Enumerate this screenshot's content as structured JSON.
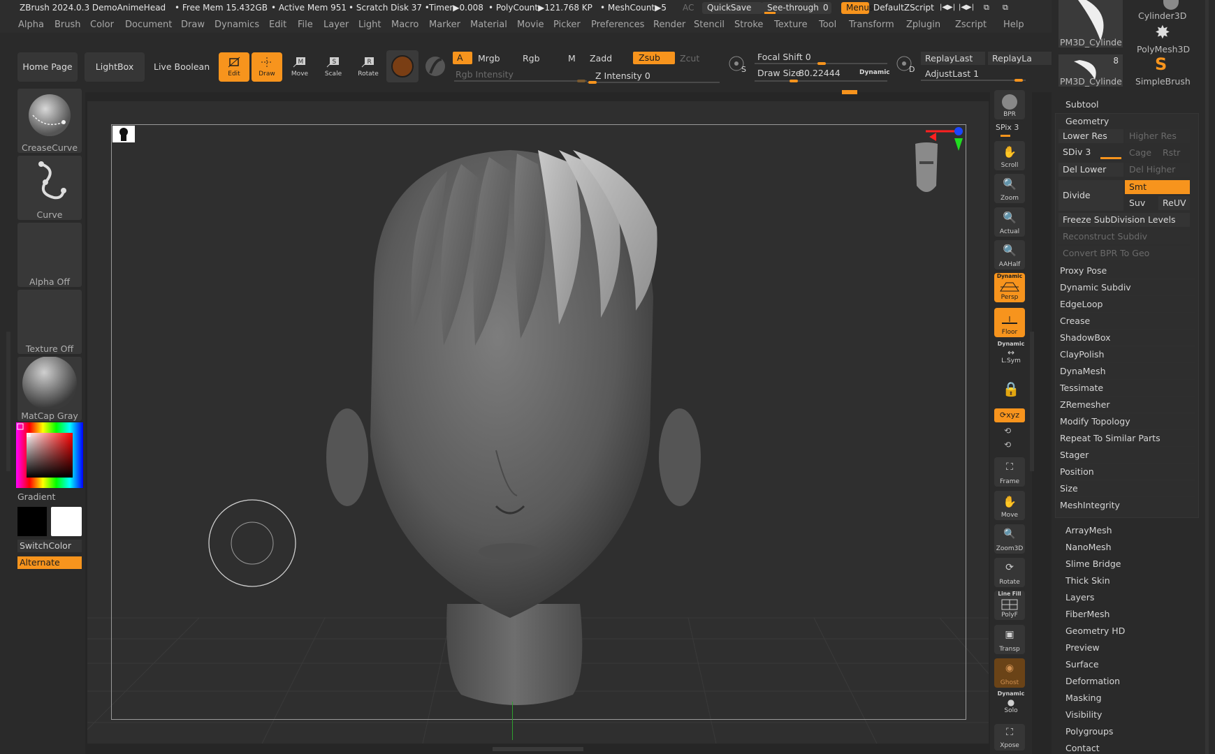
{
  "infobar": {
    "app_title": "ZBrush 2024.0.3 DemoAnimeHead",
    "free_mem": "• Free Mem 15.432GB",
    "active_mem": "• Active Mem 951",
    "scratch_disk": "• Scratch Disk 37 •",
    "timer": "Timer▶0.008",
    "polycount": "• PolyCount▶121.768 KP",
    "meshcount": "• MeshCount▶5",
    "ac": "AC",
    "quicksave": "QuickSave",
    "see_through": "See-through",
    "see_through_value": "0",
    "menus": "Menus",
    "default_zscript": "DefaultZScript"
  },
  "menubar": [
    "Alpha",
    "Brush",
    "Color",
    "Document",
    "Draw",
    "Dynamics",
    "Edit",
    "File",
    "Layer",
    "Light",
    "Macro",
    "Marker",
    "Material",
    "Movie",
    "Picker",
    "Preferences",
    "Render",
    "Stencil",
    "Stroke",
    "Texture",
    "Tool",
    "Transform",
    "Zplugin",
    "Zscript",
    "Help"
  ],
  "toolbar": {
    "home_page": "Home Page",
    "lightbox": "LightBox",
    "live_boolean": "Live Boolean",
    "edit": "Edit",
    "draw": "Draw",
    "move": "Move",
    "scale": "Scale",
    "rotate": "Rotate",
    "a": "A",
    "mrgb": "Mrgb",
    "rgb": "Rgb",
    "m": "M",
    "zadd": "Zadd",
    "zsub": "Zsub",
    "zcut": "Zcut",
    "rgb_intensity": "Rgb Intensity",
    "z_intensity": "Z Intensity 0",
    "focal_shift": "Focal Shift 0",
    "draw_size_label": "Draw Size",
    "draw_size_value": "80.22444",
    "dynamic": "Dynamic",
    "replay_last": "ReplayLast",
    "replay_last_rel": "ReplayLa",
    "adjust_last": "AdjustLast 1",
    "s_label": "S",
    "d_label": "D"
  },
  "leftshelf": {
    "brush1": "CreaseCurve",
    "brush2": "Curve",
    "alpha": "Alpha Off",
    "texture": "Texture Off",
    "material": "MatCap Gray",
    "gradient": "Gradient",
    "switchcolor": "SwitchColor",
    "alternate": "Alternate"
  },
  "righttools": {
    "bpr": "BPR",
    "spix": "SPix 3",
    "scroll": "Scroll",
    "zoom": "Zoom",
    "actual": "Actual",
    "aahalf": "AAHalf",
    "dynamic_persp_top": "Dynamic",
    "persp": "Persp",
    "floor": "Floor",
    "dynamic_lsym_top": "Dynamic",
    "lsym": "L.Sym",
    "xyz": "⟳xyz",
    "frame": "Frame",
    "move": "Move",
    "zoom3d": "Zoom3D",
    "rotate": "Rotate",
    "linefill": "Line Fill",
    "polyf": "PolyF",
    "transp": "Transp",
    "ghost": "Ghost",
    "dynamic_solo_top": "Dynamic",
    "solo": "Solo",
    "xpose": "Xpose"
  },
  "tool_thumbs": {
    "thumb1": "Cylinder3D",
    "thumb2": "PM3D_Cylinde",
    "thumb3": "PolyMesh3D",
    "thumb4": "PM3D_Cylinde",
    "thumb4_count": "8",
    "thumb5": "SimpleBrush"
  },
  "subtool_panel": {
    "subtool": "Subtool",
    "geometry": "Geometry",
    "lower_res": "Lower Res",
    "higher_res": "Higher Res",
    "sdiv": "SDiv 3",
    "cage": "Cage",
    "rstr": "Rstr",
    "del_lower": "Del Lower",
    "del_higher": "Del Higher",
    "divide": "Divide",
    "smt": "Smt",
    "suv": "Suv",
    "reuv": "ReUV",
    "geometry_items": [
      "Freeze SubDivision Levels",
      "Reconstruct Subdiv",
      "Convert BPR To Geo",
      "Proxy Pose",
      "Dynamic Subdiv",
      "EdgeLoop",
      "Crease",
      "ShadowBox",
      "ClayPolish",
      "DynaMesh",
      "Tessimate",
      "ZRemesher",
      "Modify Topology",
      "Repeat To Similar Parts",
      "Stager",
      "Position",
      "Size",
      "MeshIntegrity"
    ],
    "tool_items": [
      "ArrayMesh",
      "NanoMesh",
      "Slime Bridge",
      "Thick Skin",
      "Layers",
      "FiberMesh",
      "Geometry HD",
      "Preview",
      "Surface",
      "Deformation",
      "Masking",
      "Visibility",
      "Polygroups",
      "Contact"
    ]
  },
  "colors": {
    "accent": "#f7941d",
    "panel": "#2a2a2a",
    "viewport": "#2f2f2f"
  }
}
